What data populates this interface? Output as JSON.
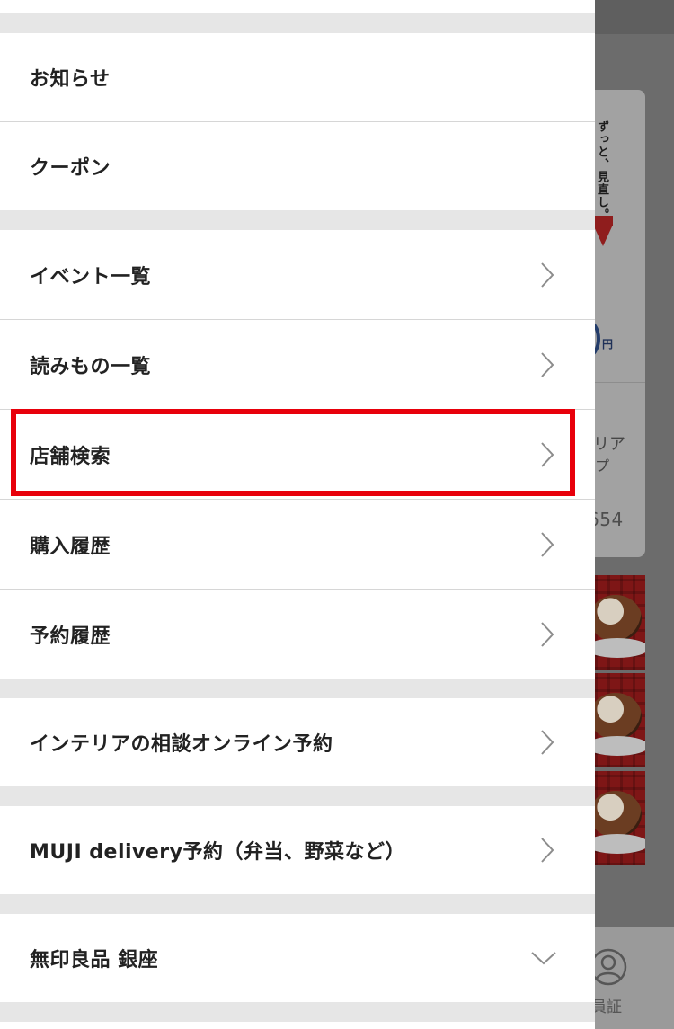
{
  "menu_groups": [
    {
      "items": [
        {
          "label": "お知らせ"
        },
        {
          "label": "クーポン"
        }
      ]
    },
    {
      "items": [
        {
          "label": "イベント一覧",
          "icon": "chevron-right-icon"
        },
        {
          "label": "読みもの一覧",
          "icon": "chevron-right-icon"
        },
        {
          "label": "店舗検索",
          "icon": "chevron-right-icon"
        },
        {
          "label": "購入履歴",
          "icon": "chevron-right-icon"
        },
        {
          "label": "予約履歴",
          "icon": "chevron-right-icon"
        }
      ]
    },
    {
      "items": [
        {
          "label": "インテリアの相談オンライン予約",
          "icon": "chevron-right-icon"
        }
      ]
    },
    {
      "items": [
        {
          "label": "MUJI delivery予約（弁当、野菜など）",
          "icon": "chevron-right-icon"
        }
      ]
    },
    {
      "items": [
        {
          "label": "無印良品 銀座",
          "icon": "chevron-down-icon"
        }
      ]
    }
  ],
  "background_page": {
    "vertical_copy": "ずっと、見直し。",
    "price_unit": "円",
    "text_fragment_1": "リア",
    "text_fragment_2": "プ",
    "number_fragment": "654",
    "nav_label_fragment": "員証",
    "nav_icon": "member-icon"
  },
  "colors": {
    "highlight": "#e8000b",
    "text": "#222222",
    "chevron": "#8c8c8c",
    "separator_band": "#e6e6e6",
    "overlay_gray": "#6c6c6c"
  }
}
